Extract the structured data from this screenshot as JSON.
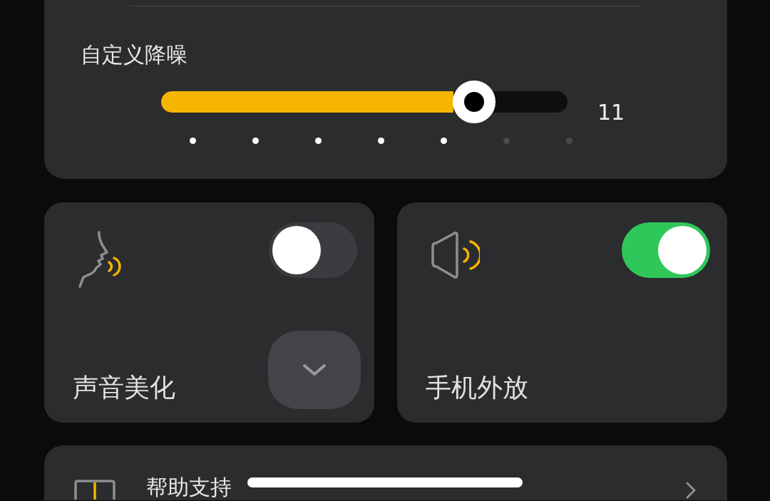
{
  "noise_control": {
    "title": "自定义降噪",
    "level": 0.77,
    "reading": "11",
    "ticks": [
      {
        "lit": true
      },
      {
        "lit": true
      },
      {
        "lit": true
      },
      {
        "lit": true
      },
      {
        "lit": true
      },
      {
        "lit": false
      },
      {
        "lit": false
      }
    ]
  },
  "tiles": [
    {
      "kind": "voice",
      "label": "声音美化",
      "on": false,
      "expandable": true
    },
    {
      "kind": "speaker",
      "label": "手机外放",
      "on": true,
      "expandable": false
    }
  ],
  "help": {
    "label": "帮助支持"
  }
}
